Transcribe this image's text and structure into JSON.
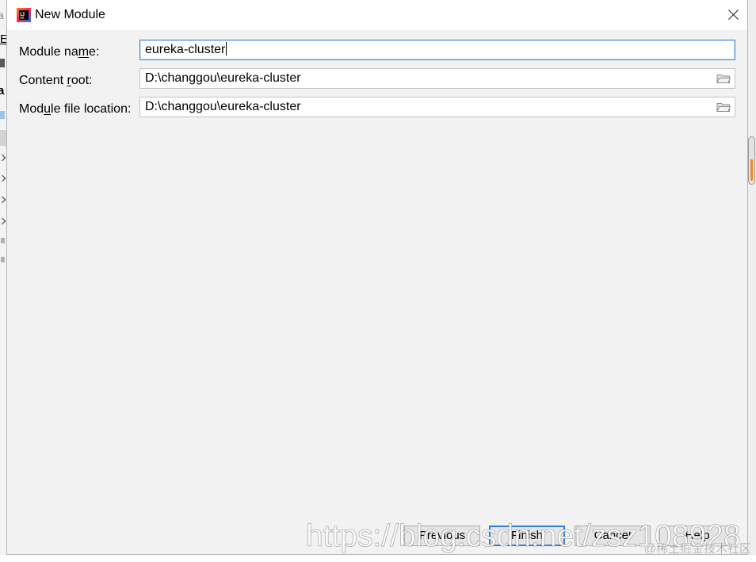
{
  "window": {
    "title": "New Module",
    "app_icon": "intellij-idea-icon",
    "app_icon_text": "IJ",
    "close_icon": "close-icon"
  },
  "form": {
    "module_name": {
      "label": "Module name:",
      "mnemonic_index": 9,
      "value": "eureka-cluster",
      "focused": true
    },
    "content_root": {
      "label": "Content root:",
      "mnemonic_index": 8,
      "value": "D:\\changgou\\eureka-cluster",
      "browse_icon": "folder-icon"
    },
    "module_file_location": {
      "label": "Module file location:",
      "mnemonic_index": 3,
      "value": "D:\\changgou\\eureka-cluster",
      "browse_icon": "folder-icon"
    }
  },
  "buttons": {
    "previous": "Previous",
    "finish": "Finish",
    "cancel": "Cancel",
    "help": "Help"
  },
  "background_ide": {
    "text_fragments": [
      "a",
      "E",
      "a"
    ],
    "tree_chevron_icon": "chevron-right-icon",
    "scrollbar_marker_color": "#f08a24"
  },
  "watermark": {
    "url": "https://blog.csdn.net/zsz108928",
    "community": "@稀土掘金技术社区"
  },
  "colors": {
    "accent_focus": "#3b8ad5",
    "default_button_border": "#2f7fd2",
    "dialog_background": "#f2f2f2",
    "title_bar_background": "#ffffff"
  }
}
